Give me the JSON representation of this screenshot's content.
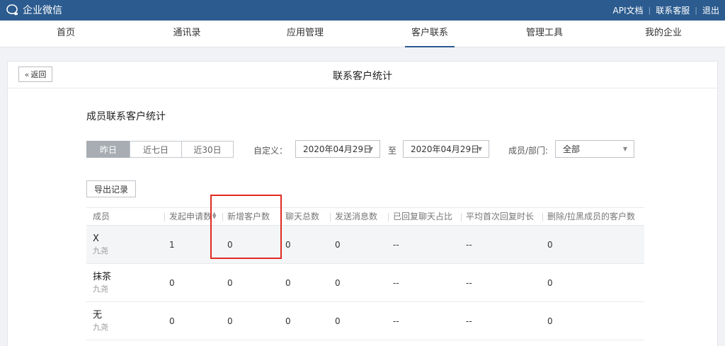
{
  "app": {
    "title": "企业微信",
    "accent": "#2b5b8f"
  },
  "top_links": [
    "API文档",
    "联系客服",
    "退出"
  ],
  "nav": [
    {
      "label": "首页",
      "active": false
    },
    {
      "label": "通讯录",
      "active": false
    },
    {
      "label": "应用管理",
      "active": false
    },
    {
      "label": "客户联系",
      "active": true
    },
    {
      "label": "管理工具",
      "active": false
    },
    {
      "label": "我的企业",
      "active": false
    }
  ],
  "page": {
    "back_label": "返回",
    "title": "联系客户统计"
  },
  "section": {
    "title": "成员联系客户统计",
    "ranges": [
      {
        "label": "昨日",
        "active": true
      },
      {
        "label": "近七日",
        "active": false
      },
      {
        "label": "近30日",
        "active": false
      }
    ],
    "custom_label": "自定义：",
    "start_date": "2020年04月29日",
    "to_label": "至",
    "end_date": "2020年04月29日",
    "member_label": "成员/部门:",
    "member_value": "全部",
    "export_label": "导出记录"
  },
  "table": {
    "columns": [
      "成员",
      "发起申请数",
      "新增客户数",
      "聊天总数",
      "发送消息数",
      "已回复聊天占比",
      "平均首次回复时长",
      "删除/拉黑成员的客户数"
    ],
    "rows": [
      {
        "name": "X",
        "dept": "九尧",
        "values": [
          "1",
          "0",
          "0",
          "0",
          "--",
          "--",
          "0"
        ],
        "highlighted": true
      },
      {
        "name": "抹茶",
        "dept": "九尧",
        "values": [
          "0",
          "0",
          "0",
          "0",
          "--",
          "--",
          "0"
        ],
        "highlighted": false
      },
      {
        "name": "无",
        "dept": "九尧",
        "values": [
          "0",
          "0",
          "0",
          "0",
          "--",
          "--",
          "0"
        ],
        "highlighted": false
      }
    ]
  },
  "annotation": {
    "color": "#e02a22",
    "target": "新增客户数"
  }
}
